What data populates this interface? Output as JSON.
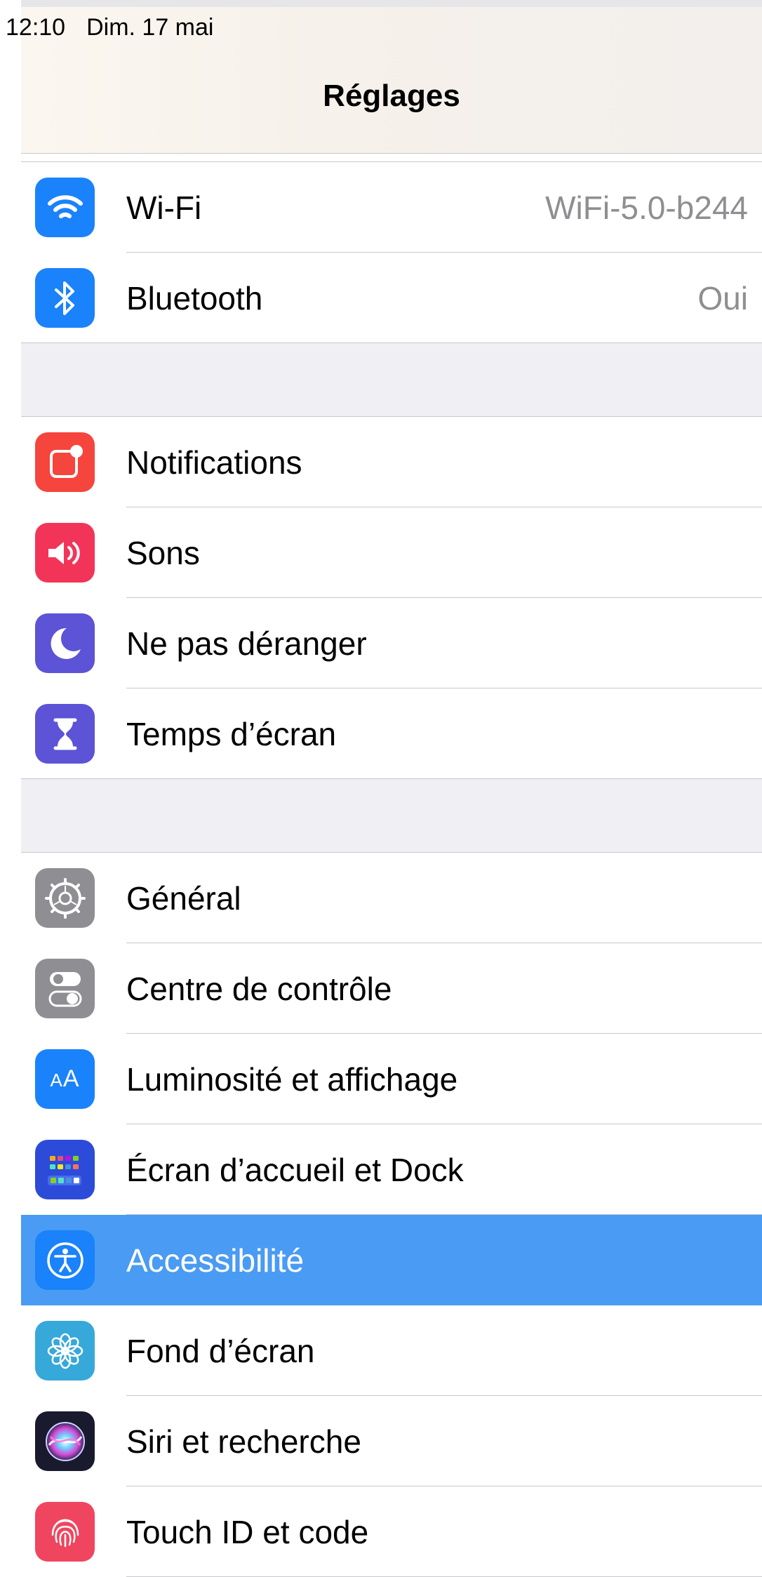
{
  "status_bar": {
    "time": "12:10",
    "date": "Dim. 17 mai"
  },
  "nav": {
    "title": "Réglages"
  },
  "groups": [
    {
      "items": [
        {
          "label": "Wi-Fi",
          "value": "WiFi-5.0-b244",
          "icon": "wifi-icon",
          "color": "#1a82fb"
        },
        {
          "label": "Bluetooth",
          "value": "Oui",
          "icon": "bluetooth-icon",
          "color": "#1a82fb"
        }
      ]
    },
    {
      "items": [
        {
          "label": "Notifications",
          "icon": "notifications-icon",
          "color": "#f5453d"
        },
        {
          "label": "Sons",
          "icon": "speaker-icon",
          "color": "#f33459"
        },
        {
          "label": "Ne pas déranger",
          "icon": "moon-icon",
          "color": "#5c53d6"
        },
        {
          "label": "Temps d’écran",
          "icon": "hourglass-icon",
          "color": "#5c53d6"
        }
      ]
    },
    {
      "items": [
        {
          "label": "Général",
          "icon": "gear-icon",
          "color": "#8e8e93"
        },
        {
          "label": "Centre de contrôle",
          "icon": "toggles-icon",
          "color": "#8e8e93"
        },
        {
          "label": "Luminosité et affichage",
          "icon": "text-size-icon",
          "color": "#1a82fb"
        },
        {
          "label": "Écran d’accueil et Dock",
          "icon": "home-screen-icon",
          "color": "#2c4bd8"
        },
        {
          "label": "Accessibilité",
          "icon": "accessibility-icon",
          "color": "#1a82fb",
          "selected": true
        },
        {
          "label": "Fond d’écran",
          "icon": "flower-icon",
          "color": "#36a8d9"
        },
        {
          "label": "Siri et recherche",
          "icon": "siri-icon",
          "color": "#1a1a2e"
        },
        {
          "label": "Touch ID et code",
          "icon": "fingerprint-icon",
          "color": "#f0455f"
        }
      ]
    }
  ],
  "accent": "#4a9bf3"
}
